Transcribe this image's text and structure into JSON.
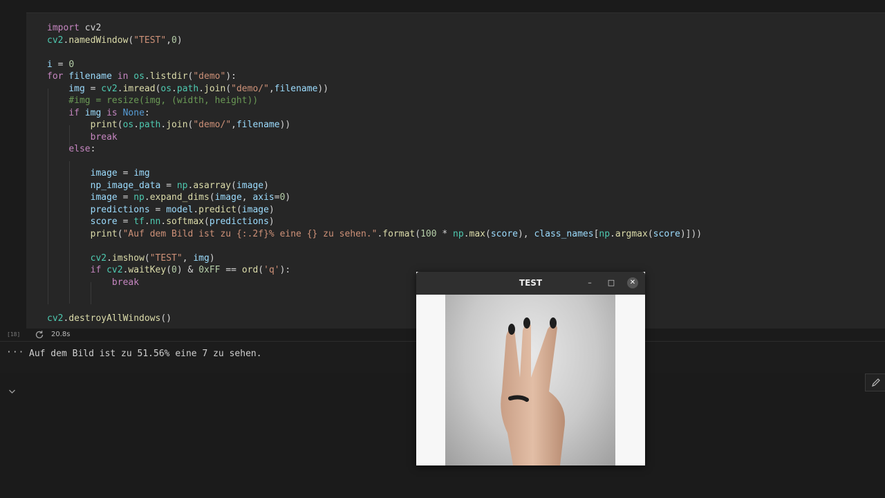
{
  "code": {
    "lines": [
      [
        {
          "t": "import",
          "c": "kw"
        },
        {
          "t": " cv2",
          "c": ""
        }
      ],
      [
        {
          "t": "cv2",
          "c": "mod"
        },
        {
          "t": ".",
          "c": ""
        },
        {
          "t": "namedWindow",
          "c": "fn"
        },
        {
          "t": "(",
          "c": ""
        },
        {
          "t": "\"TEST\"",
          "c": "str"
        },
        {
          "t": ",",
          "c": ""
        },
        {
          "t": "0",
          "c": "num"
        },
        {
          "t": ")",
          "c": ""
        }
      ],
      [],
      [
        {
          "t": "i",
          "c": "var"
        },
        {
          "t": " = ",
          "c": ""
        },
        {
          "t": "0",
          "c": "num"
        }
      ],
      [
        {
          "t": "for",
          "c": "kw"
        },
        {
          "t": " filename ",
          "c": "var"
        },
        {
          "t": "in",
          "c": "kw"
        },
        {
          "t": " os",
          "c": "mod"
        },
        {
          "t": ".",
          "c": ""
        },
        {
          "t": "listdir",
          "c": "fn"
        },
        {
          "t": "(",
          "c": ""
        },
        {
          "t": "\"demo\"",
          "c": "str"
        },
        {
          "t": "):",
          "c": ""
        }
      ],
      [
        {
          "t": "    img",
          "c": "var"
        },
        {
          "t": " = ",
          "c": ""
        },
        {
          "t": "cv2",
          "c": "mod"
        },
        {
          "t": ".",
          "c": ""
        },
        {
          "t": "imread",
          "c": "fn"
        },
        {
          "t": "(",
          "c": ""
        },
        {
          "t": "os",
          "c": "mod"
        },
        {
          "t": ".",
          "c": ""
        },
        {
          "t": "path",
          "c": "mod"
        },
        {
          "t": ".",
          "c": ""
        },
        {
          "t": "join",
          "c": "fn"
        },
        {
          "t": "(",
          "c": ""
        },
        {
          "t": "\"demo/\"",
          "c": "str"
        },
        {
          "t": ",",
          "c": ""
        },
        {
          "t": "filename",
          "c": "var"
        },
        {
          "t": "))",
          "c": ""
        }
      ],
      [
        {
          "t": "    #img = resize(img, (width, height))",
          "c": "cm"
        }
      ],
      [
        {
          "t": "    ",
          "c": ""
        },
        {
          "t": "if",
          "c": "kw"
        },
        {
          "t": " img ",
          "c": "var"
        },
        {
          "t": "is",
          "c": "kw"
        },
        {
          "t": " None",
          "c": "kw2"
        },
        {
          "t": ":",
          "c": ""
        }
      ],
      [
        {
          "t": "        ",
          "c": ""
        },
        {
          "t": "print",
          "c": "fn"
        },
        {
          "t": "(",
          "c": ""
        },
        {
          "t": "os",
          "c": "mod"
        },
        {
          "t": ".",
          "c": ""
        },
        {
          "t": "path",
          "c": "mod"
        },
        {
          "t": ".",
          "c": ""
        },
        {
          "t": "join",
          "c": "fn"
        },
        {
          "t": "(",
          "c": ""
        },
        {
          "t": "\"demo/\"",
          "c": "str"
        },
        {
          "t": ",",
          "c": ""
        },
        {
          "t": "filename",
          "c": "var"
        },
        {
          "t": "))",
          "c": ""
        }
      ],
      [
        {
          "t": "        ",
          "c": ""
        },
        {
          "t": "break",
          "c": "kw"
        }
      ],
      [
        {
          "t": "    ",
          "c": ""
        },
        {
          "t": "else",
          "c": "kw"
        },
        {
          "t": ":",
          "c": ""
        }
      ],
      [],
      [
        {
          "t": "        image",
          "c": "var"
        },
        {
          "t": " = ",
          "c": ""
        },
        {
          "t": "img",
          "c": "var"
        }
      ],
      [
        {
          "t": "        np_image_data",
          "c": "var"
        },
        {
          "t": " = ",
          "c": ""
        },
        {
          "t": "np",
          "c": "mod"
        },
        {
          "t": ".",
          "c": ""
        },
        {
          "t": "asarray",
          "c": "fn"
        },
        {
          "t": "(",
          "c": ""
        },
        {
          "t": "image",
          "c": "var"
        },
        {
          "t": ")",
          "c": ""
        }
      ],
      [
        {
          "t": "        image",
          "c": "var"
        },
        {
          "t": " = ",
          "c": ""
        },
        {
          "t": "np",
          "c": "mod"
        },
        {
          "t": ".",
          "c": ""
        },
        {
          "t": "expand_dims",
          "c": "fn"
        },
        {
          "t": "(",
          "c": ""
        },
        {
          "t": "image",
          "c": "var"
        },
        {
          "t": ", ",
          "c": ""
        },
        {
          "t": "axis",
          "c": "var"
        },
        {
          "t": "=",
          "c": ""
        },
        {
          "t": "0",
          "c": "num"
        },
        {
          "t": ")",
          "c": ""
        }
      ],
      [
        {
          "t": "        predictions",
          "c": "var"
        },
        {
          "t": " = ",
          "c": ""
        },
        {
          "t": "model",
          "c": "var"
        },
        {
          "t": ".",
          "c": ""
        },
        {
          "t": "predict",
          "c": "fn"
        },
        {
          "t": "(",
          "c": ""
        },
        {
          "t": "image",
          "c": "var"
        },
        {
          "t": ")",
          "c": ""
        }
      ],
      [
        {
          "t": "        score",
          "c": "var"
        },
        {
          "t": " = ",
          "c": ""
        },
        {
          "t": "tf",
          "c": "mod"
        },
        {
          "t": ".",
          "c": ""
        },
        {
          "t": "nn",
          "c": "mod"
        },
        {
          "t": ".",
          "c": ""
        },
        {
          "t": "softmax",
          "c": "fn"
        },
        {
          "t": "(",
          "c": ""
        },
        {
          "t": "predictions",
          "c": "var"
        },
        {
          "t": ")",
          "c": ""
        }
      ],
      [
        {
          "t": "        ",
          "c": ""
        },
        {
          "t": "print",
          "c": "fn"
        },
        {
          "t": "(",
          "c": ""
        },
        {
          "t": "\"Auf dem Bild ist zu {:.2f}% eine {} zu sehen.\"",
          "c": "str"
        },
        {
          "t": ".",
          "c": ""
        },
        {
          "t": "format",
          "c": "fn"
        },
        {
          "t": "(",
          "c": ""
        },
        {
          "t": "100",
          "c": "num"
        },
        {
          "t": " * ",
          "c": ""
        },
        {
          "t": "np",
          "c": "mod"
        },
        {
          "t": ".",
          "c": ""
        },
        {
          "t": "max",
          "c": "fn"
        },
        {
          "t": "(",
          "c": ""
        },
        {
          "t": "score",
          "c": "var"
        },
        {
          "t": "), ",
          "c": ""
        },
        {
          "t": "class_names",
          "c": "var"
        },
        {
          "t": "[",
          "c": ""
        },
        {
          "t": "np",
          "c": "mod"
        },
        {
          "t": ".",
          "c": ""
        },
        {
          "t": "argmax",
          "c": "fn"
        },
        {
          "t": "(",
          "c": ""
        },
        {
          "t": "score",
          "c": "var"
        },
        {
          "t": ")]))",
          "c": ""
        }
      ],
      [],
      [
        {
          "t": "        ",
          "c": ""
        },
        {
          "t": "cv2",
          "c": "mod"
        },
        {
          "t": ".",
          "c": ""
        },
        {
          "t": "imshow",
          "c": "fn"
        },
        {
          "t": "(",
          "c": ""
        },
        {
          "t": "\"TEST\"",
          "c": "str"
        },
        {
          "t": ", ",
          "c": ""
        },
        {
          "t": "img",
          "c": "var"
        },
        {
          "t": ")",
          "c": ""
        }
      ],
      [
        {
          "t": "        ",
          "c": ""
        },
        {
          "t": "if",
          "c": "kw"
        },
        {
          "t": " cv2",
          "c": "mod"
        },
        {
          "t": ".",
          "c": ""
        },
        {
          "t": "waitKey",
          "c": "fn"
        },
        {
          "t": "(",
          "c": ""
        },
        {
          "t": "0",
          "c": "num"
        },
        {
          "t": ") & ",
          "c": ""
        },
        {
          "t": "0xFF",
          "c": "num"
        },
        {
          "t": " == ",
          "c": ""
        },
        {
          "t": "ord",
          "c": "fn"
        },
        {
          "t": "(",
          "c": ""
        },
        {
          "t": "'q'",
          "c": "str"
        },
        {
          "t": "):",
          "c": ""
        }
      ],
      [
        {
          "t": "            ",
          "c": ""
        },
        {
          "t": "break",
          "c": "kw"
        }
      ],
      [],
      [],
      [
        {
          "t": "cv2",
          "c": "mod"
        },
        {
          "t": ".",
          "c": ""
        },
        {
          "t": "destroyAllWindows",
          "c": "fn"
        },
        {
          "t": "()",
          "c": ""
        }
      ]
    ]
  },
  "cell": {
    "execution_count": "[18]",
    "exec_time": "20.8s"
  },
  "output": {
    "dots": "···",
    "text": "Auf dem Bild ist zu 51.56% eine 7 zu sehen."
  },
  "window": {
    "title": "TEST",
    "minimize": "–",
    "maximize": "□",
    "close": "✕"
  },
  "icons": {
    "refresh": "refresh-icon",
    "chevron": "chevron-down-icon",
    "pencil": "pencil-icon"
  }
}
